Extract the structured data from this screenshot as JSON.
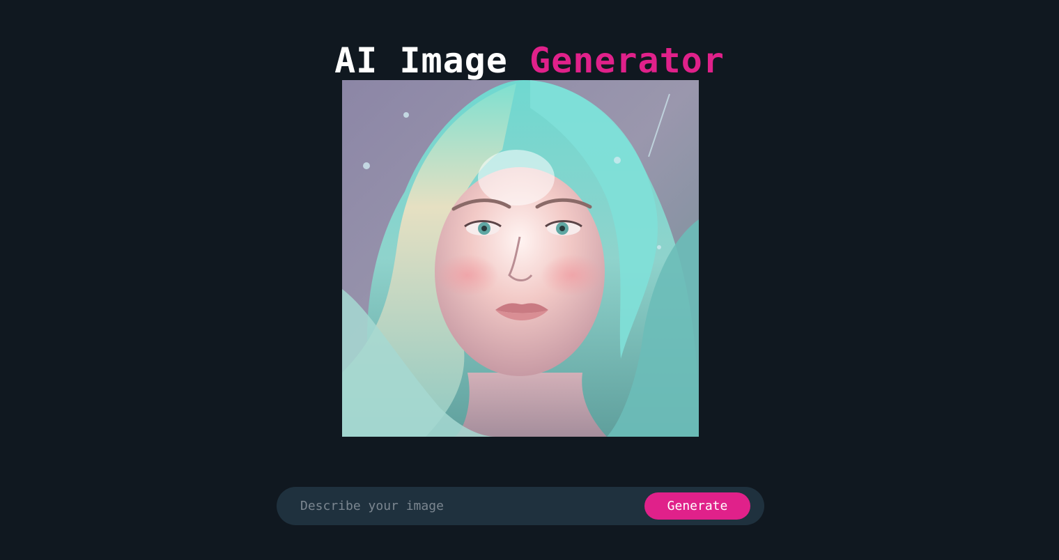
{
  "header": {
    "title_part1": "AI Image ",
    "title_part2": "Generator",
    "accent_color": "#e0218a"
  },
  "image": {
    "alt": "AI generated portrait with pastel teal and blonde flowing hair"
  },
  "prompt": {
    "placeholder": "Describe your image",
    "value": "",
    "button_label": "Generate"
  },
  "colors": {
    "background": "#101820",
    "input_bg": "#1f313e",
    "button_bg": "#e0218a"
  }
}
